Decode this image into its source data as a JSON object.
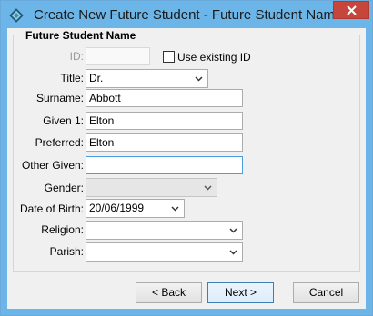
{
  "window": {
    "title": "Create New Future Student - Future Student Name",
    "accent_color": "#6cb5e8",
    "close_color": "#c7463c"
  },
  "group": {
    "title": "Future Student Name"
  },
  "form": {
    "id": {
      "label": "ID:",
      "value": ""
    },
    "use_existing_id": {
      "label": "Use existing ID",
      "checked": false
    },
    "title": {
      "label": "Title:",
      "value": "Dr."
    },
    "surname": {
      "label": "Surname:",
      "value": "Abbott"
    },
    "given1": {
      "label": "Given 1:",
      "value": "Elton"
    },
    "preferred": {
      "label": "Preferred:",
      "value": "Elton"
    },
    "other_given": {
      "label": "Other Given:",
      "value": ""
    },
    "gender": {
      "label": "Gender:",
      "value": ""
    },
    "dob": {
      "label": "Date of Birth:",
      "value": "20/06/1999"
    },
    "religion": {
      "label": "Religion:",
      "value": ""
    },
    "parish": {
      "label": "Parish:",
      "value": ""
    }
  },
  "buttons": {
    "back": "< Back",
    "next": "Next >",
    "cancel": "Cancel"
  }
}
